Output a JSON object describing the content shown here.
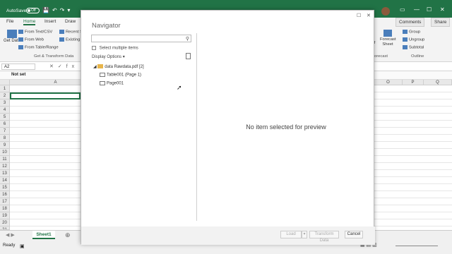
{
  "titlebar": {
    "autosave_label": "AutoSave",
    "toggle_label": "Off"
  },
  "ribbon": {
    "tabs": [
      "File",
      "Home",
      "Insert",
      "Draw"
    ],
    "get_data_label": "Get Data",
    "from_text_csv": "From Text/CSV",
    "from_web": "From Web",
    "from_table_range": "From Table/Range",
    "recent_sources": "Recent S",
    "existing": "Existing",
    "group_label": "Get & Transform Data",
    "comments": "Comments",
    "share": "Share",
    "forecast_sheet": "Forecast Sheet",
    "forecast_partial": "orecast",
    "what_if": "If",
    "group": "Group",
    "ungroup": "Ungroup",
    "subtotal": "Subtotal",
    "outline": "Outline"
  },
  "formula_bar": {
    "name_box": "A2"
  },
  "notes_bar": {
    "label": "Not set"
  },
  "grid": {
    "columns_left": [
      "A"
    ],
    "columns_right": [
      "O",
      "P",
      "Q"
    ],
    "rows": [
      "1",
      "2",
      "3",
      "4",
      "5",
      "6",
      "7",
      "8",
      "9",
      "10",
      "11",
      "12",
      "13",
      "14",
      "15",
      "16",
      "17",
      "18",
      "19",
      "20",
      "21"
    ]
  },
  "sheets": {
    "tab": "Sheet1"
  },
  "status": {
    "ready": "Ready"
  },
  "navigator": {
    "title": "Navigator",
    "search_placeholder": "",
    "select_multiple": "Select multiple items",
    "display_options": "Display Options",
    "tree": [
      {
        "label": "data Rawdata.pdf [2]",
        "icon": "folder-icon"
      },
      {
        "label": "Table001 (Page 1)",
        "icon": "table-icon"
      },
      {
        "label": "Page001",
        "icon": "page-icon"
      }
    ],
    "preview_message": "No item selected for preview",
    "load": "Load",
    "transform": "Transform Data",
    "cancel": "Cancel"
  }
}
